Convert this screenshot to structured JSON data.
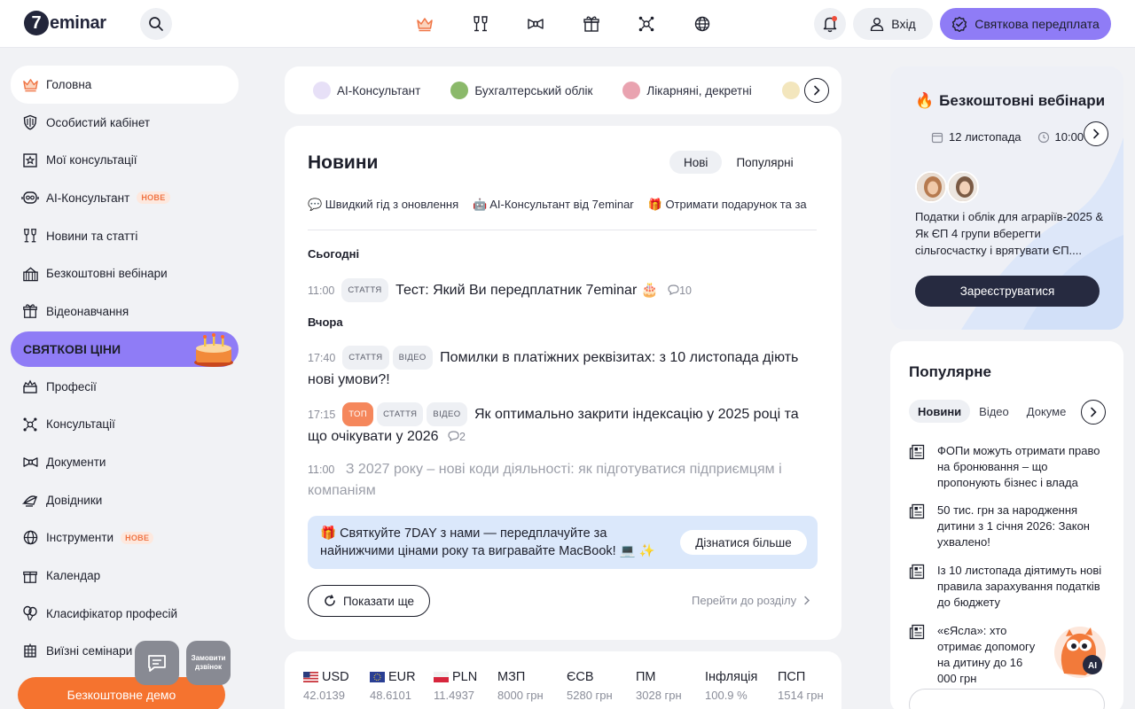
{
  "header": {
    "logo_mark": "7",
    "logo_text": "eminar",
    "login_label": "Вхід",
    "subscribe_label": "Святкова передплата",
    "nav_icons": [
      "crown-icon",
      "glasses-icon",
      "bowtie-icon",
      "gift-icon",
      "network-icon",
      "globe-icon"
    ]
  },
  "sidebar": {
    "items": [
      {
        "label": "Головна",
        "icon": "crown-icon",
        "active": true
      },
      {
        "label": "Особистий кабінет",
        "icon": "shield-icon"
      },
      {
        "label": "Мої консультації",
        "icon": "star-calendar-icon"
      },
      {
        "label": "AI-Консультант",
        "icon": "robot-icon",
        "badge": "НОВЕ"
      },
      {
        "label": "Новини та статті",
        "icon": "glasses-icon"
      },
      {
        "label": "Безкоштовні вебінари",
        "icon": "gift-box-icon"
      },
      {
        "label": "Відеонавчання",
        "icon": "present-icon"
      }
    ],
    "promo_label": "СВЯТКОВІ ЦІНИ",
    "items2": [
      {
        "label": "Професії",
        "icon": "cake-icon"
      },
      {
        "label": "Консультації",
        "icon": "network-icon"
      },
      {
        "label": "Документи",
        "icon": "bowtie-icon"
      },
      {
        "label": "Довідники",
        "icon": "party-hat-icon"
      },
      {
        "label": "Інструменти",
        "icon": "globe-icon",
        "badge": "НОВЕ"
      },
      {
        "label": "Календар",
        "icon": "gift-icon"
      },
      {
        "label": "Класифікатор професій",
        "icon": "balloons-icon"
      },
      {
        "label": "Виїзні семінари",
        "icon": "lantern-icon"
      }
    ],
    "cta_label": "Безкоштовне демо",
    "callback_label": "Замовити дзвінок"
  },
  "tags": [
    "AI-Консультант",
    "Бухгалтерський облік",
    "Лікарняні, декретні"
  ],
  "news": {
    "title": "Новини",
    "tabs": [
      "Нові",
      "Популярні"
    ],
    "quick_links": [
      "💬 Швидкий гід з оновлення",
      "🤖 AI-Консультант від 7eminar",
      "🎁 Отримати подарунок та за"
    ],
    "today_label": "Сьогодні",
    "yesterday_label": "Вчора",
    "items": [
      {
        "time": "11:00",
        "pills": [
          "СТАТТЯ"
        ],
        "title": "Тест: Який Ви передплатник 7eminar 🎂",
        "comments": "10"
      },
      {
        "time": "17:40",
        "pills": [
          "СТАТТЯ",
          "ВІДЕО"
        ],
        "title": "Помилки в платіжних реквізитах: з 10 листопада діють нові умови?!"
      },
      {
        "time": "17:15",
        "top": "ТОП",
        "pills": [
          "СТАТТЯ",
          "ВІДЕО"
        ],
        "title": "Як оптимально закрити індексацію у 2025 році та що очікувати у 2026",
        "comments": "2"
      },
      {
        "time": "11:00",
        "title": "З 2027 року – нові коди діяльності: як підготуватися підприємцям і компаніям"
      }
    ],
    "banner_text": "🎁 Святкуйте 7DAY з нами — передплачуйте за найнижчими цінами року та вигравайте MacBook! 💻 ✨",
    "banner_button": "Дізнатися більше",
    "more_label": "Показати ще",
    "goto_label": "Перейти до розділу"
  },
  "rates": [
    {
      "name": "USD",
      "value": "42.0139",
      "flag": "us"
    },
    {
      "name": "EUR",
      "value": "48.6101",
      "flag": "eu"
    },
    {
      "name": "PLN",
      "value": "11.4937",
      "flag": "pl"
    },
    {
      "name": "МЗП",
      "value": "8000 грн"
    },
    {
      "name": "ЄСВ",
      "value": "5280 грн"
    },
    {
      "name": "ПМ",
      "value": "3028 грн"
    },
    {
      "name": "Інфляція",
      "value": "100.9 %"
    },
    {
      "name": "ПСП",
      "value": "1514 грн"
    }
  ],
  "webinars": {
    "title": "Безкоштовні вебінари",
    "date": "12 листопада",
    "time": "10:00",
    "description": "Податки і облік для аграріїв-2025 & Як ЄП 4 групи вберегти сільгосчастку і врятувати ЄП....",
    "register_label": "Зареєструватися"
  },
  "popular": {
    "title": "Популярне",
    "tabs": [
      "Новини",
      "Відео",
      "Докуме"
    ],
    "items": [
      "ФОПи можуть отримати право на бронювання – що пропонують бізнес і влада",
      "50 тис. грн за народження дитини з 1 січня 2026: Закон ухвалено!",
      "Із 10 листопада діятимуть нові правила зарахування податків до бюджету",
      "«єЯсла»: хто отримає допомогу на дитину до 16 000 грн"
    ]
  },
  "mascot_badge": "AI",
  "colors": {
    "accent": "#8f7cf6",
    "orange": "#f5732f",
    "dark": "#262a40"
  }
}
